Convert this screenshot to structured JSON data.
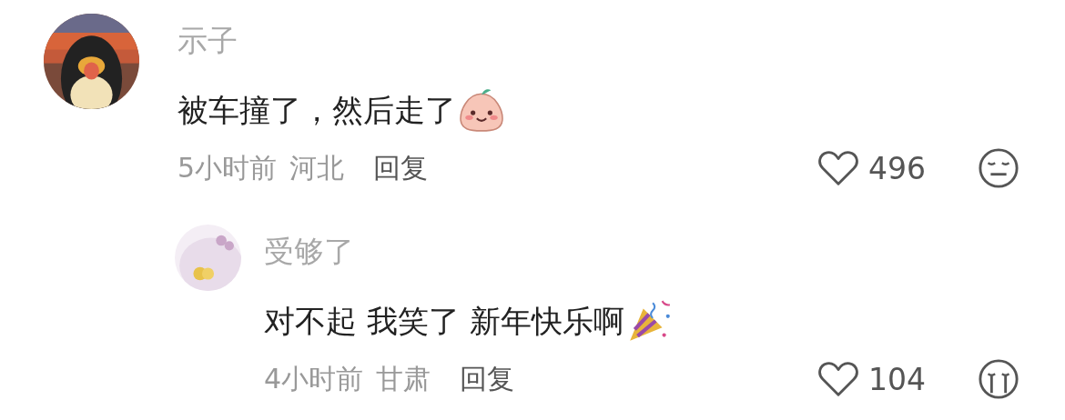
{
  "comments": [
    {
      "author": "示子",
      "text": "被车撞了，然后走了",
      "time": "5小时前",
      "location": "河北",
      "reply_label": "回复",
      "likes": "496",
      "children": [
        {
          "author": "受够了",
          "text": "对不起 我笑了 新年快乐啊",
          "time": "4小时前",
          "location": "甘肃",
          "reply_label": "回复",
          "likes": "104"
        }
      ]
    }
  ]
}
